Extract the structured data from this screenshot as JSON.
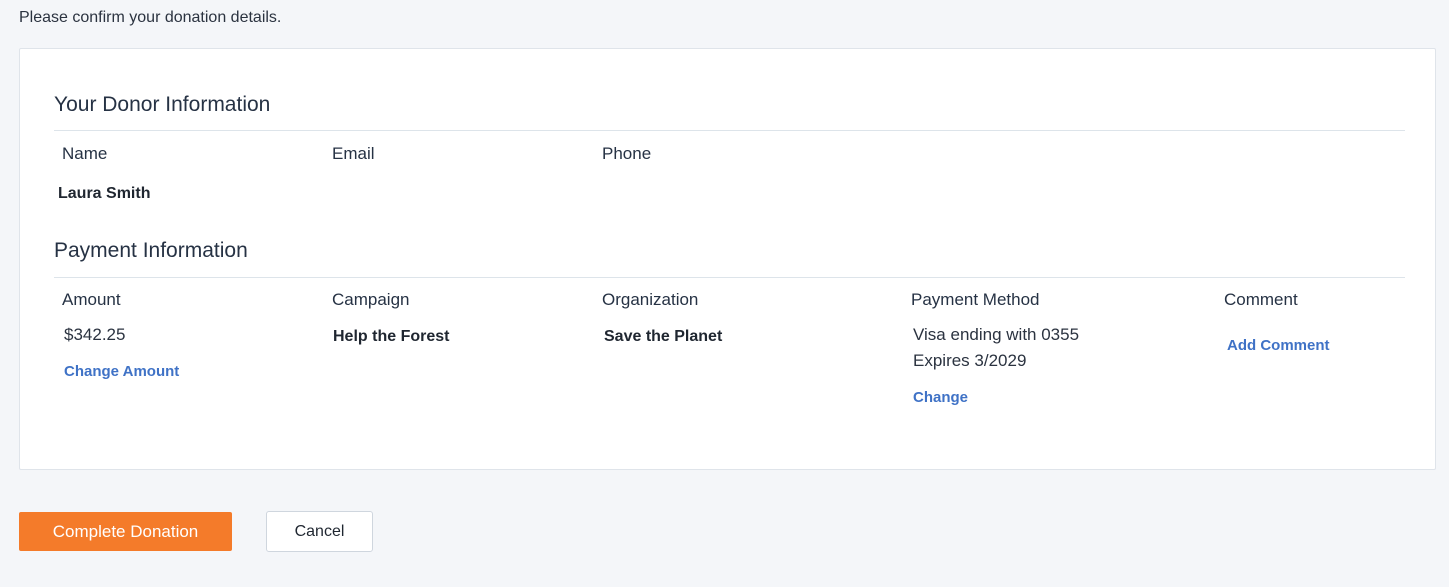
{
  "intro": "Please confirm your donation details.",
  "donor": {
    "title": "Your Donor Information",
    "headers": {
      "name": "Name",
      "email": "Email",
      "phone": "Phone"
    },
    "values": {
      "name": "Laura Smith",
      "email": "",
      "phone": ""
    }
  },
  "payment": {
    "title": "Payment Information",
    "headers": {
      "amount": "Amount",
      "campaign": "Campaign",
      "organization": "Organization",
      "method": "Payment Method",
      "comment": "Comment"
    },
    "values": {
      "amount": "$342.25",
      "campaign": "Help the Forest",
      "organization": "Save the Planet",
      "method_line1": "Visa ending with 0355",
      "method_line2": "Expires 3/2029"
    },
    "links": {
      "change_amount": "Change Amount",
      "change_method": "Change",
      "add_comment": "Add Comment"
    }
  },
  "actions": {
    "complete": "Complete Donation",
    "cancel": "Cancel"
  },
  "colors": {
    "primary": "#f47b2a",
    "link": "#3f72c6",
    "background": "#f4f6f9"
  }
}
